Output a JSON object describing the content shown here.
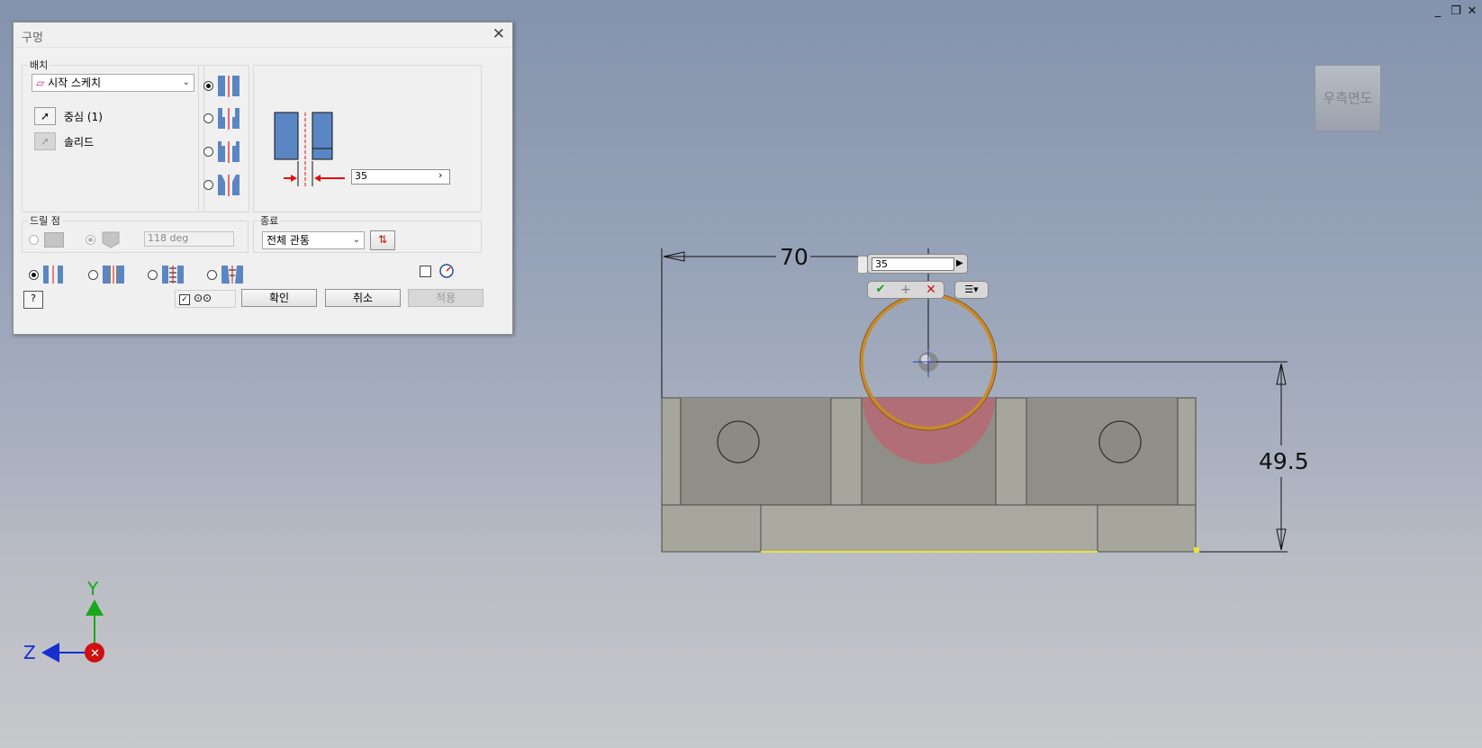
{
  "window_controls": {
    "minimize": "_",
    "restore": "❐",
    "close": "✕"
  },
  "dialog": {
    "title": "구멍",
    "close_glyph": "✕",
    "placement": {
      "label": "배치",
      "mode": "시작 스케치",
      "center_label": "중심 (1)",
      "solid_label": "솔리드"
    },
    "diameter_value": "35",
    "drill_point": {
      "label": "드릴 점",
      "angle": "118 deg"
    },
    "termination": {
      "label": "종료",
      "value": "전체 관통"
    },
    "buttons": {
      "ok": "확인",
      "cancel": "취소",
      "apply": "적용"
    }
  },
  "viewport": {
    "dim_horizontal": "70",
    "dim_vertical": "49.5",
    "mini_toolbar_value": "35",
    "view_cube_label": "우측면도",
    "axes": {
      "y": "Y",
      "z": "Z"
    }
  },
  "colors": {
    "accent_red": "#e01010",
    "hole_blue": "#5b86c4",
    "hole_preview": "#c88a2a",
    "axis_y": "#1aa81a",
    "axis_z": "#1630d0",
    "axis_x": "#d01010"
  }
}
